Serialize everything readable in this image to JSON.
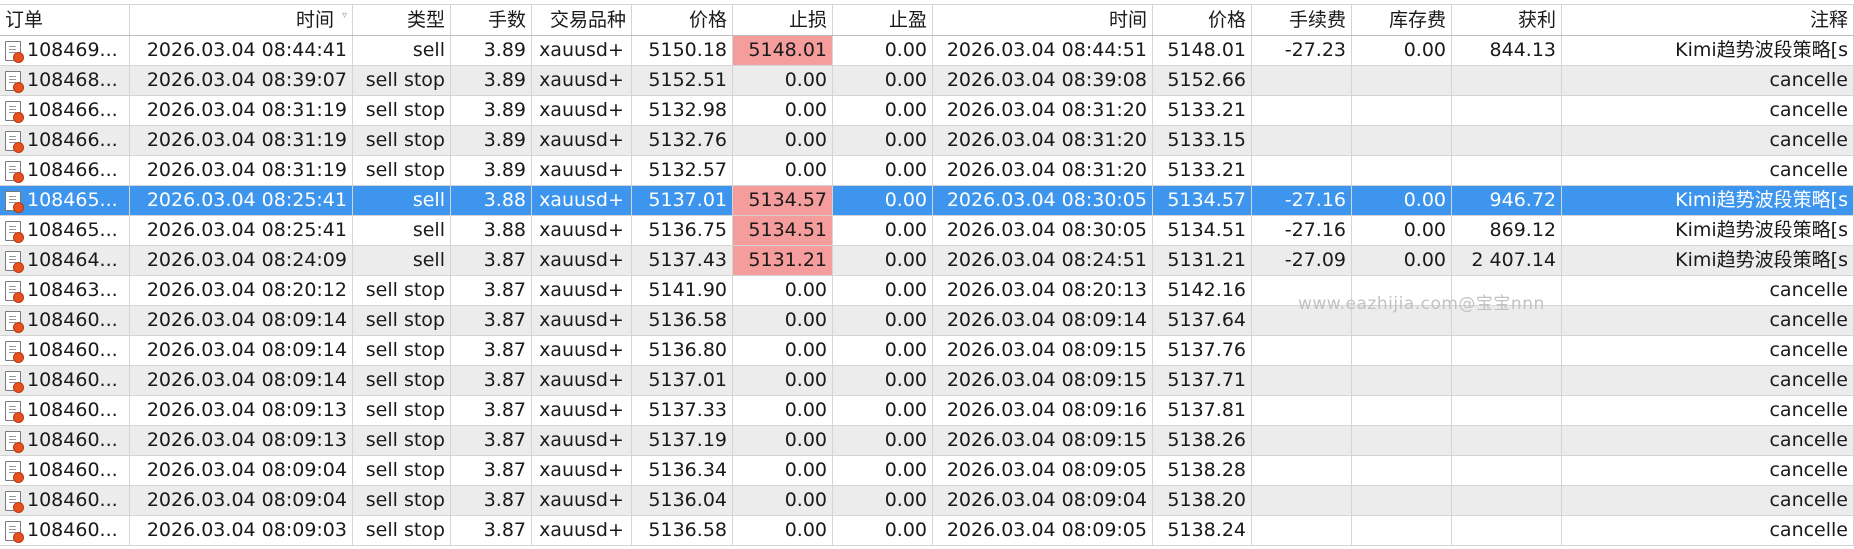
{
  "columns": {
    "order": "订单",
    "open_time": "时间",
    "type": "类型",
    "lots": "手数",
    "symbol": "交易品种",
    "open_price": "价格",
    "sl": "止损",
    "tp": "止盈",
    "close_time": "时间",
    "close_price": "价格",
    "commission": "手续费",
    "swap": "库存费",
    "profit": "获利",
    "comment": "注释"
  },
  "icons": {
    "row_icon": "order-document-icon",
    "sort": "sort-indicator-icon"
  },
  "colors": {
    "selected_row": "#3d95ee",
    "stop_loss_hit": "#f59c9c",
    "even_row": "#ececec"
  },
  "watermark": "www.eazhijia.com@宝宝nnn",
  "rows": [
    {
      "order": "108469...",
      "open_time": "2026.03.04 08:44:41",
      "type": "sell",
      "lots": "3.89",
      "symbol": "xauusd+",
      "open_price": "5150.18",
      "sl": "5148.01",
      "tp": "0.00",
      "close_time": "2026.03.04 08:44:51",
      "close_price": "5148.01",
      "commission": "-27.23",
      "swap": "0.00",
      "profit": "844.13",
      "comment": "Kimi趋势波段策略[s"
    },
    {
      "order": "108468...",
      "open_time": "2026.03.04 08:39:07",
      "type": "sell stop",
      "lots": "3.89",
      "symbol": "xauusd+",
      "open_price": "5152.51",
      "sl": "0.00",
      "tp": "0.00",
      "close_time": "2026.03.04 08:39:08",
      "close_price": "5152.66",
      "commission": "",
      "swap": "",
      "profit": "",
      "comment": "cancelle"
    },
    {
      "order": "108466...",
      "open_time": "2026.03.04 08:31:19",
      "type": "sell stop",
      "lots": "3.89",
      "symbol": "xauusd+",
      "open_price": "5132.98",
      "sl": "0.00",
      "tp": "0.00",
      "close_time": "2026.03.04 08:31:20",
      "close_price": "5133.21",
      "commission": "",
      "swap": "",
      "profit": "",
      "comment": "cancelle"
    },
    {
      "order": "108466...",
      "open_time": "2026.03.04 08:31:19",
      "type": "sell stop",
      "lots": "3.89",
      "symbol": "xauusd+",
      "open_price": "5132.76",
      "sl": "0.00",
      "tp": "0.00",
      "close_time": "2026.03.04 08:31:20",
      "close_price": "5133.15",
      "commission": "",
      "swap": "",
      "profit": "",
      "comment": "cancelle"
    },
    {
      "order": "108466...",
      "open_time": "2026.03.04 08:31:19",
      "type": "sell stop",
      "lots": "3.89",
      "symbol": "xauusd+",
      "open_price": "5132.57",
      "sl": "0.00",
      "tp": "0.00",
      "close_time": "2026.03.04 08:31:20",
      "close_price": "5133.21",
      "commission": "",
      "swap": "",
      "profit": "",
      "comment": "cancelle"
    },
    {
      "order": "108465...",
      "open_time": "2026.03.04 08:25:41",
      "type": "sell",
      "lots": "3.88",
      "symbol": "xauusd+",
      "open_price": "5137.01",
      "sl": "5134.57",
      "tp": "0.00",
      "close_time": "2026.03.04 08:30:05",
      "close_price": "5134.57",
      "commission": "-27.16",
      "swap": "0.00",
      "profit": "946.72",
      "comment": "Kimi趋势波段策略[s"
    },
    {
      "order": "108465...",
      "open_time": "2026.03.04 08:25:41",
      "type": "sell",
      "lots": "3.88",
      "symbol": "xauusd+",
      "open_price": "5136.75",
      "sl": "5134.51",
      "tp": "0.00",
      "close_time": "2026.03.04 08:30:05",
      "close_price": "5134.51",
      "commission": "-27.16",
      "swap": "0.00",
      "profit": "869.12",
      "comment": "Kimi趋势波段策略[s"
    },
    {
      "order": "108464...",
      "open_time": "2026.03.04 08:24:09",
      "type": "sell",
      "lots": "3.87",
      "symbol": "xauusd+",
      "open_price": "5137.43",
      "sl": "5131.21",
      "tp": "0.00",
      "close_time": "2026.03.04 08:24:51",
      "close_price": "5131.21",
      "commission": "-27.09",
      "swap": "0.00",
      "profit": "2 407.14",
      "comment": "Kimi趋势波段策略[s"
    },
    {
      "order": "108463...",
      "open_time": "2026.03.04 08:20:12",
      "type": "sell stop",
      "lots": "3.87",
      "symbol": "xauusd+",
      "open_price": "5141.90",
      "sl": "0.00",
      "tp": "0.00",
      "close_time": "2026.03.04 08:20:13",
      "close_price": "5142.16",
      "commission": "",
      "swap": "",
      "profit": "",
      "comment": "cancelle"
    },
    {
      "order": "108460...",
      "open_time": "2026.03.04 08:09:14",
      "type": "sell stop",
      "lots": "3.87",
      "symbol": "xauusd+",
      "open_price": "5136.58",
      "sl": "0.00",
      "tp": "0.00",
      "close_time": "2026.03.04 08:09:14",
      "close_price": "5137.64",
      "commission": "",
      "swap": "",
      "profit": "",
      "comment": "cancelle"
    },
    {
      "order": "108460...",
      "open_time": "2026.03.04 08:09:14",
      "type": "sell stop",
      "lots": "3.87",
      "symbol": "xauusd+",
      "open_price": "5136.80",
      "sl": "0.00",
      "tp": "0.00",
      "close_time": "2026.03.04 08:09:15",
      "close_price": "5137.76",
      "commission": "",
      "swap": "",
      "profit": "",
      "comment": "cancelle"
    },
    {
      "order": "108460...",
      "open_time": "2026.03.04 08:09:14",
      "type": "sell stop",
      "lots": "3.87",
      "symbol": "xauusd+",
      "open_price": "5137.01",
      "sl": "0.00",
      "tp": "0.00",
      "close_time": "2026.03.04 08:09:15",
      "close_price": "5137.71",
      "commission": "",
      "swap": "",
      "profit": "",
      "comment": "cancelle"
    },
    {
      "order": "108460...",
      "open_time": "2026.03.04 08:09:13",
      "type": "sell stop",
      "lots": "3.87",
      "symbol": "xauusd+",
      "open_price": "5137.33",
      "sl": "0.00",
      "tp": "0.00",
      "close_time": "2026.03.04 08:09:16",
      "close_price": "5137.81",
      "commission": "",
      "swap": "",
      "profit": "",
      "comment": "cancelle"
    },
    {
      "order": "108460...",
      "open_time": "2026.03.04 08:09:13",
      "type": "sell stop",
      "lots": "3.87",
      "symbol": "xauusd+",
      "open_price": "5137.19",
      "sl": "0.00",
      "tp": "0.00",
      "close_time": "2026.03.04 08:09:15",
      "close_price": "5138.26",
      "commission": "",
      "swap": "",
      "profit": "",
      "comment": "cancelle"
    },
    {
      "order": "108460...",
      "open_time": "2026.03.04 08:09:04",
      "type": "sell stop",
      "lots": "3.87",
      "symbol": "xauusd+",
      "open_price": "5136.34",
      "sl": "0.00",
      "tp": "0.00",
      "close_time": "2026.03.04 08:09:05",
      "close_price": "5138.28",
      "commission": "",
      "swap": "",
      "profit": "",
      "comment": "cancelle"
    },
    {
      "order": "108460...",
      "open_time": "2026.03.04 08:09:04",
      "type": "sell stop",
      "lots": "3.87",
      "symbol": "xauusd+",
      "open_price": "5136.04",
      "sl": "0.00",
      "tp": "0.00",
      "close_time": "2026.03.04 08:09:04",
      "close_price": "5138.20",
      "commission": "",
      "swap": "",
      "profit": "",
      "comment": "cancelle"
    },
    {
      "order": "108460...",
      "open_time": "2026.03.04 08:09:03",
      "type": "sell stop",
      "lots": "3.87",
      "symbol": "xauusd+",
      "open_price": "5136.58",
      "sl": "0.00",
      "tp": "0.00",
      "close_time": "2026.03.04 08:09:05",
      "close_price": "5138.24",
      "commission": "",
      "swap": "",
      "profit": "",
      "comment": "cancelle"
    }
  ],
  "selected_row_index": 5,
  "stop_loss_hit_rows": [
    0,
    5,
    6,
    7
  ]
}
